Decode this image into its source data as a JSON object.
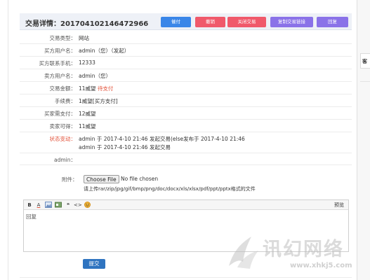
{
  "header": {
    "title": "交易详情：201704102146472966",
    "buttons": [
      {
        "label": "催付",
        "color": "#3a86e8"
      },
      {
        "label": "撤销",
        "color": "#f0596b"
      },
      {
        "label": "关闭交易",
        "color": "#f0596b"
      },
      {
        "label": "复制交易链接",
        "color": "#8a72e8"
      },
      {
        "label": "回复",
        "color": "#8a72e8"
      }
    ]
  },
  "fields": {
    "trade_type": {
      "label": "交易类型：",
      "value": "网站"
    },
    "buyer": {
      "label": "买方用户名：",
      "value": "admin（您）（发起）"
    },
    "buyer_phone": {
      "label": "买方联系手机：",
      "value": "12333"
    },
    "seller": {
      "label": "卖方用户名：",
      "value": "admin（您）"
    },
    "amount": {
      "label": "交易金额：",
      "value": "11威望",
      "status": "待支付"
    },
    "fee": {
      "label": "手续费：",
      "value": "1威望[买方支付]"
    },
    "buyer_pay": {
      "label": "买家需支付：",
      "value": "12威望"
    },
    "seller_get": {
      "label": "卖家可得：",
      "value": "11威望"
    },
    "status_change": {
      "label": "状态变动：",
      "lines": [
        "admin 于 2017-4-10 21:46 发起交易(else发布于 2017-4-10 21:46",
        "admin 于 2017-4-10 21:46 发起交易"
      ]
    },
    "admin_reply": {
      "label": "admin："
    }
  },
  "attachment": {
    "label": "附件：",
    "button_label": "Choose File",
    "status": "No file chosen",
    "hint": "请上传rar/zip/jpg/gif/bmp/png/doc/docx/xls/xlsx/pdf/ppt/pptx格式的文件"
  },
  "editor": {
    "toolbar": [
      "B",
      "A",
      "▭",
      "▭",
      "❝",
      "<>",
      "☺"
    ],
    "preview_label": "预览",
    "placeholder": "回复"
  },
  "submit_label": "提交",
  "right_panel": {
    "label": "客"
  },
  "watermark": {
    "main": "讯幻网络",
    "url": "www.xhkj5.com"
  },
  "colors": {
    "link": "#2a6ebb",
    "status_red": "#e3543c",
    "submit": "#2f74c0",
    "header_bg": "#eef1f7"
  }
}
